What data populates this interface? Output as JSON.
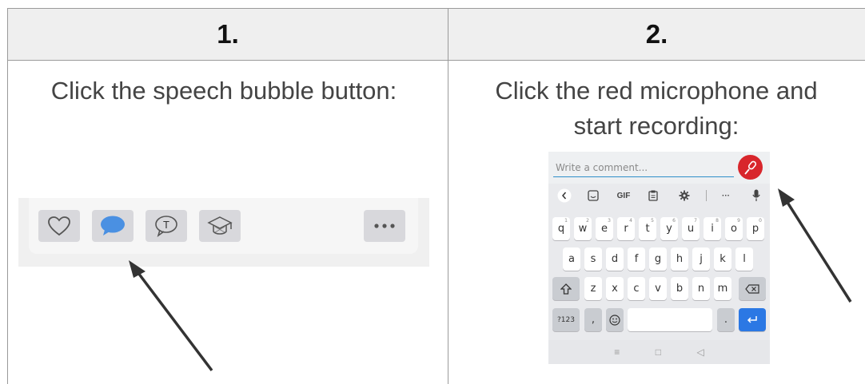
{
  "table": {
    "col1": {
      "step": "1.",
      "instruction": "Click the speech bubble button:",
      "actions": [
        {
          "icon": "heart-icon",
          "selected": false
        },
        {
          "icon": "speech-bubble-icon",
          "selected": true
        },
        {
          "icon": "translate-bubble-icon",
          "selected": false,
          "glyph": "T"
        },
        {
          "icon": "graduation-cap-icon",
          "selected": false
        },
        {
          "icon": "more-icon",
          "selected": false
        }
      ]
    },
    "col2": {
      "step": "2.",
      "instruction_line1": "Click the red microphone and",
      "instruction_line2": "start recording:",
      "keyboard": {
        "comment_placeholder": "Write a comment...",
        "toolbar": {
          "gif": "GIF",
          "more": "···"
        },
        "row1": [
          "q",
          "w",
          "e",
          "r",
          "t",
          "y",
          "u",
          "i",
          "o",
          "p"
        ],
        "row1_hints": [
          "1",
          "2",
          "3",
          "4",
          "5",
          "6",
          "7",
          "8",
          "9",
          "0"
        ],
        "row2": [
          "a",
          "s",
          "d",
          "f",
          "g",
          "h",
          "j",
          "k",
          "l"
        ],
        "row3": [
          "z",
          "x",
          "c",
          "v",
          "b",
          "n",
          "m"
        ],
        "symbols_key": "?123",
        "comma_key": ",",
        "period_key": ".",
        "nav": [
          "≡",
          "□",
          "◁"
        ]
      }
    }
  },
  "colors": {
    "accent_blue": "#4a90e2",
    "mic_red": "#d8262c",
    "enter_blue": "#2b78e4"
  }
}
